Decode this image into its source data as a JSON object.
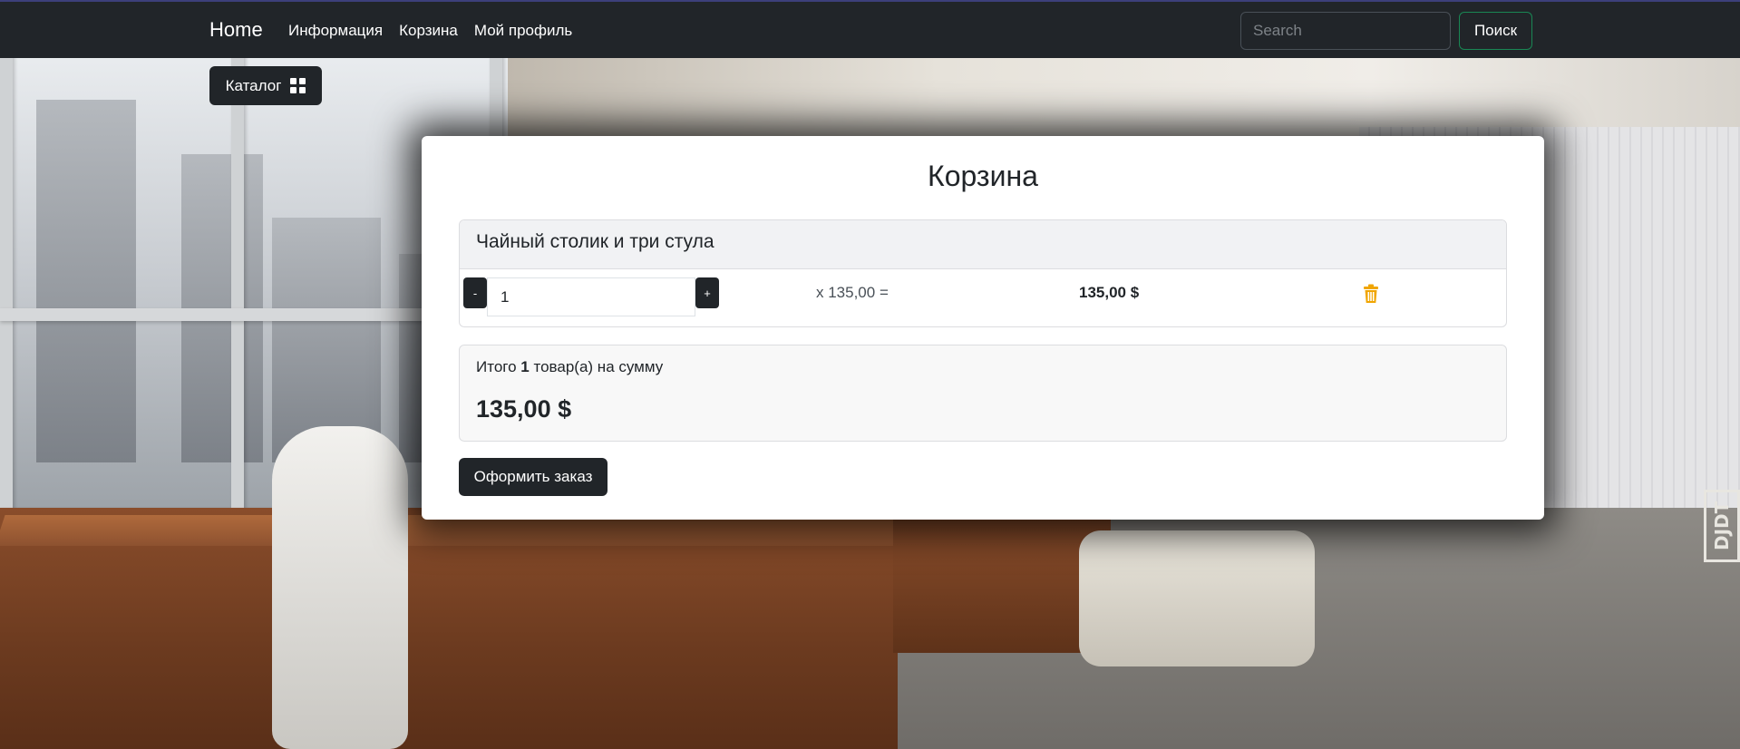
{
  "navbar": {
    "brand": "Home",
    "links": [
      "Информация",
      "Корзина",
      "Мой профиль"
    ],
    "search_placeholder": "Search",
    "search_button": "Поиск"
  },
  "catalog": {
    "label": "Каталог",
    "icon": "grid-icon"
  },
  "cart": {
    "title": "Корзина",
    "items": [
      {
        "name": "Чайный столик и три стула",
        "minus_label": "-",
        "plus_label": "+",
        "quantity": "1",
        "unit_price_text": "x 135,00 =",
        "line_total": "135,00 $",
        "remove_icon": "trash-icon"
      }
    ],
    "summary": {
      "prefix": "Итого",
      "count": "1",
      "suffix": "товар(а) на сумму",
      "total": "135,00 $"
    },
    "checkout_label": "Оформить заказ"
  },
  "watermark": "DJDT",
  "colors": {
    "navbar_bg": "#212529",
    "search_button_border": "#198754",
    "trash_icon": "#f0a500"
  }
}
